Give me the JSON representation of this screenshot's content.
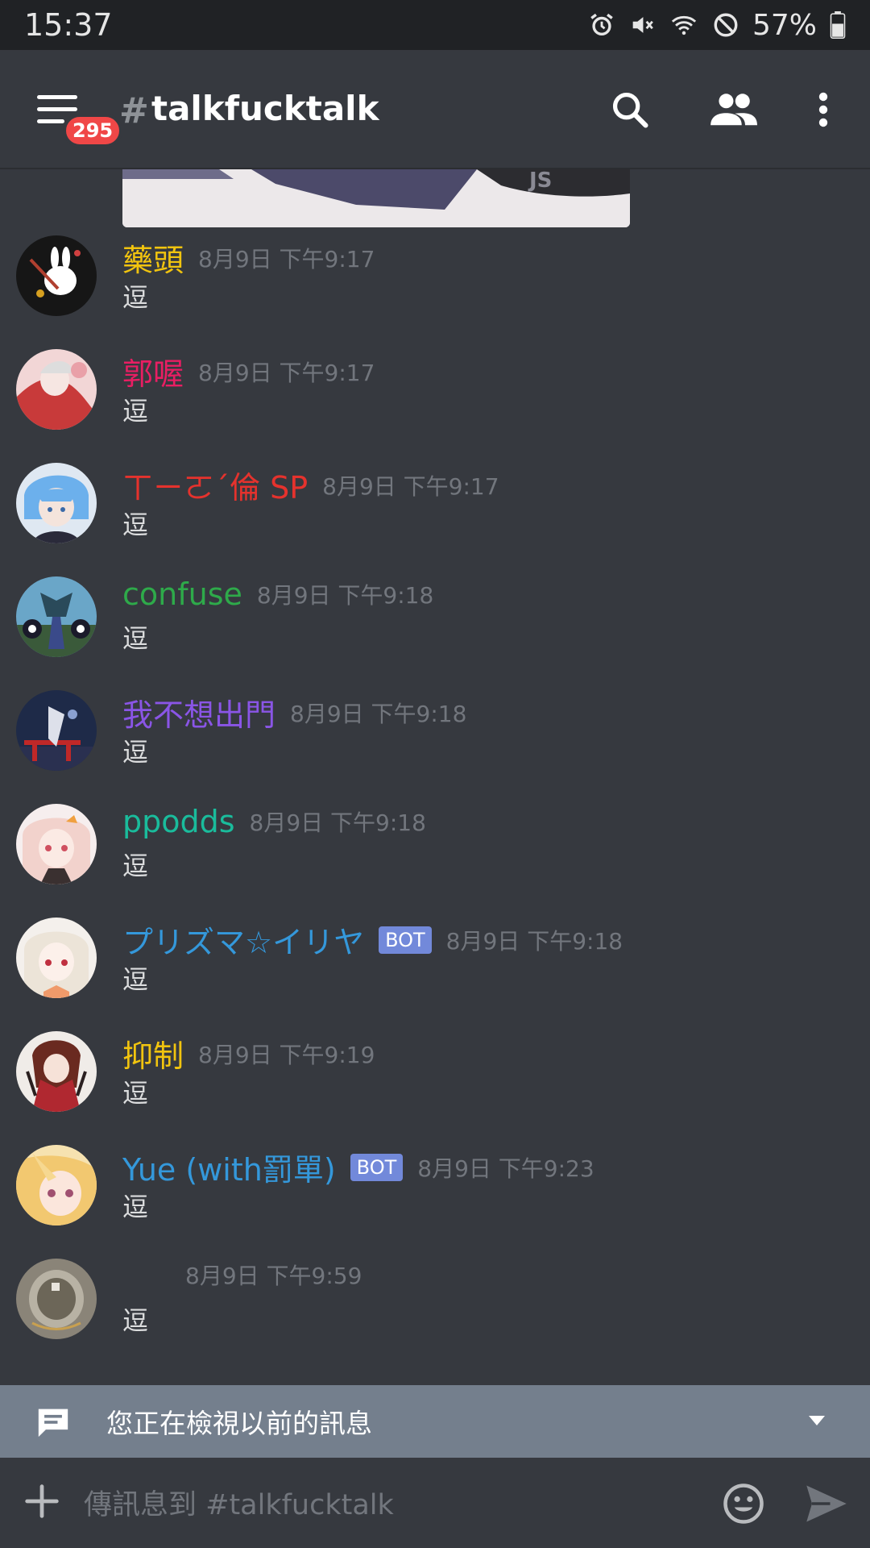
{
  "status_bar": {
    "time": "15:37",
    "battery": "57%"
  },
  "header": {
    "unread_count": "295",
    "hash": "#",
    "channel_name": "talkfucktalk"
  },
  "messages": [
    {
      "author": "藥頭",
      "author_color": "#f1c40f",
      "bot": false,
      "timestamp": "8月9日 下午9:17",
      "text": "逗",
      "avatar_color": "#1a1a1a"
    },
    {
      "author": "郭喔",
      "author_color": "#e91e63",
      "bot": false,
      "timestamp": "8月9日 下午9:17",
      "text": "逗",
      "avatar_color": "#e8b4b8"
    },
    {
      "author": "ㄒㄧㄛˊ倫 SP",
      "author_color": "#e5322d",
      "bot": false,
      "timestamp": "8月9日 下午9:17",
      "text": "逗",
      "avatar_color": "#7ab8e8"
    },
    {
      "author": "confuse",
      "author_color": "#2eaa4a",
      "bot": false,
      "timestamp": "8月9日 下午9:18",
      "text": "逗",
      "avatar_color": "#4a6a5a"
    },
    {
      "author": "我不想出門",
      "author_color": "#8a55e6",
      "bot": false,
      "timestamp": "8月9日 下午9:18",
      "text": "逗",
      "avatar_color": "#2a3a5a"
    },
    {
      "author": "ppodds",
      "author_color": "#1abc9c",
      "bot": false,
      "timestamp": "8月9日 下午9:18",
      "text": "逗",
      "avatar_color": "#f0d0cc"
    },
    {
      "author": "プリズマ☆イリヤ",
      "author_color": "#3498db",
      "bot": true,
      "bot_label": "BOT",
      "timestamp": "8月9日 下午9:18",
      "text": "逗",
      "avatar_color": "#ece4dc"
    },
    {
      "author": "抑制",
      "author_color": "#f1c40f",
      "bot": false,
      "timestamp": "8月9日 下午9:19",
      "text": "逗",
      "avatar_color": "#b05040"
    },
    {
      "author": "Yue (with罰單)",
      "author_color": "#3498db",
      "bot": true,
      "bot_label": "BOT",
      "timestamp": "8月9日 下午9:23",
      "text": "逗",
      "avatar_color": "#f0d090"
    },
    {
      "author": "",
      "author_color": "#dcddde",
      "bot": false,
      "timestamp": "8月9日 下午9:59",
      "text": "逗",
      "avatar_color": "#8a8478"
    }
  ],
  "older_bar": {
    "text": "您正在檢視以前的訊息"
  },
  "composer": {
    "placeholder": "傳訊息到 #talkfucktalk"
  },
  "icons": [
    "menu-icon",
    "search-icon",
    "members-icon",
    "more-vertical-icon",
    "chat-bubble-icon",
    "chevron-down-icon",
    "plus-icon",
    "emoji-icon",
    "send-icon",
    "alarm-icon",
    "mute-icon",
    "wifi-icon",
    "block-icon",
    "battery-icon"
  ]
}
